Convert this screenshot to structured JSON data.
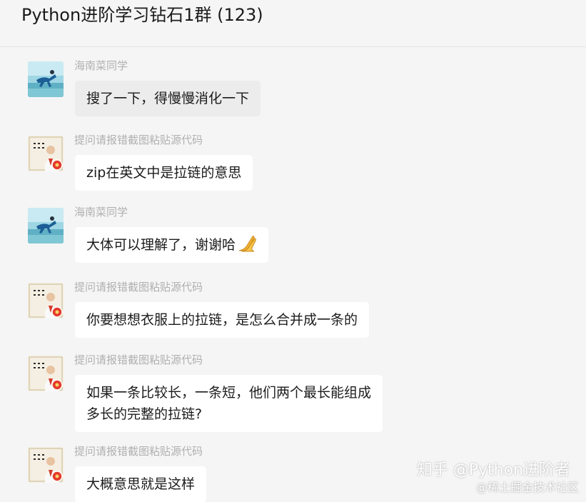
{
  "header": {
    "title": "Python进阶学习钻石1群 (123)"
  },
  "messages": [
    {
      "sender": "海南菜同学",
      "avatar_icon": "diver-beach-avatar-icon",
      "lines": [
        "搜了一下，得慢慢消化一下"
      ]
    },
    {
      "sender": "提问请报错截图粘贴源代码",
      "avatar_icon": "portrait-calligraphy-avatar-icon",
      "lines": [
        "zip在英文中是拉链的意思"
      ]
    },
    {
      "sender": "海南菜同学",
      "avatar_icon": "diver-beach-avatar-icon",
      "lines": [
        "大体可以理解了，谢谢哈"
      ],
      "emoji": "clasped-hands-emoji"
    },
    {
      "sender": "提问请报错截图粘贴源代码",
      "avatar_icon": "portrait-calligraphy-avatar-icon",
      "lines": [
        "你要想想衣服上的拉链，是怎么合并成一条的"
      ]
    },
    {
      "sender": "提问请报错截图粘贴源代码",
      "avatar_icon": "portrait-calligraphy-avatar-icon",
      "lines": [
        "如果一条比较长，一条短，他们两个最长能组成",
        "多长的完整的拉链?"
      ]
    },
    {
      "sender": "提问请报错截图粘贴源代码",
      "avatar_icon": "portrait-calligraphy-avatar-icon",
      "lines": [
        "大概意思就是这样"
      ]
    }
  ],
  "watermark": {
    "main": "知乎 @Python进阶者",
    "sub": "@稀土掘金技术社区"
  },
  "colors": {
    "background": "#f5f5f5",
    "bubble": "#ffffff",
    "bubble_selected": "#ececec",
    "sender_name": "#b0b0b0",
    "avatar_badge": "#e53b2c"
  }
}
